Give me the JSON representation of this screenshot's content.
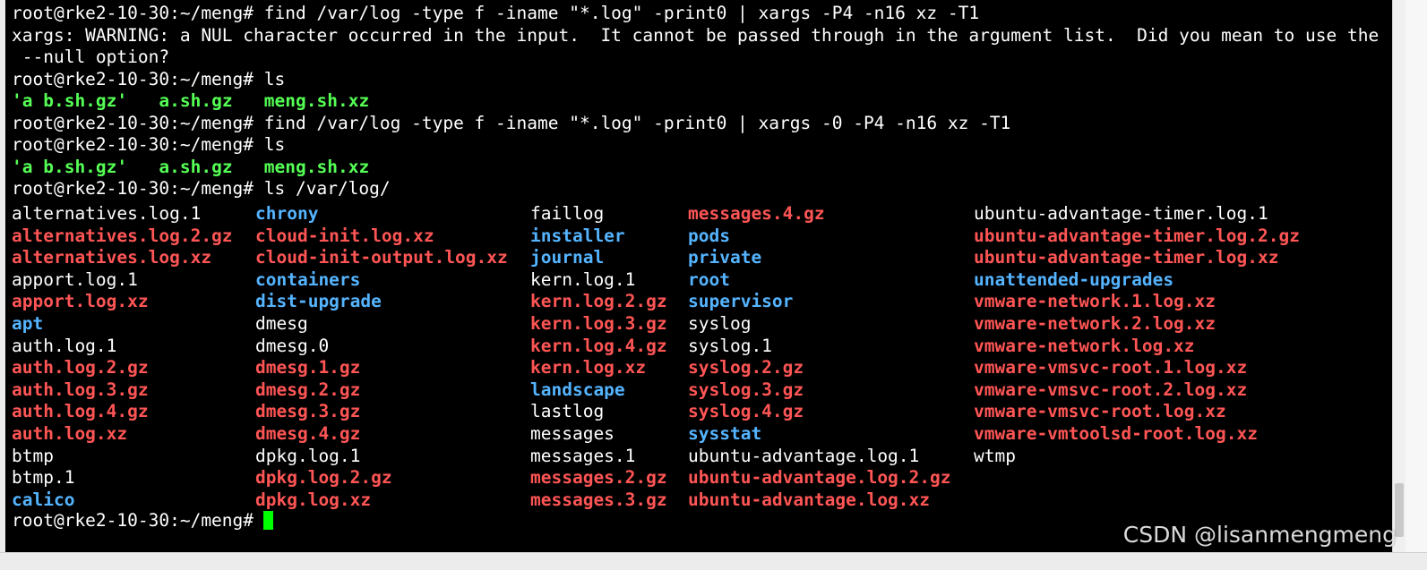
{
  "terminal": {
    "lines": [
      {
        "text": "root@rke2-10-30:~/meng# find /var/log -type f -iname \"*.log\" -print0 | xargs -P4 -n16 xz -T1"
      },
      {
        "text": "xargs: WARNING: a NUL character occurred in the input.  It cannot be passed through in the argument list.  Did you mean to use the"
      },
      {
        "text": " --null option?"
      },
      {
        "text": "root@rke2-10-30:~/meng# ls"
      },
      {
        "files": [
          "'a b.sh.gz'",
          "a.sh.gz",
          "meng.sh.xz"
        ]
      },
      {
        "text": "root@rke2-10-30:~/meng# find /var/log -type f -iname \"*.log\" -print0 | xargs -0 -P4 -n16 xz -T1"
      },
      {
        "text": "root@rke2-10-30:~/meng# ls"
      },
      {
        "files": [
          "'a b.sh.gz'",
          "a.sh.gz",
          "meng.sh.xz"
        ]
      },
      {
        "text": "root@rke2-10-30:~/meng# ls /var/log/"
      }
    ],
    "columns": [
      [
        {
          "name": "alternatives.log.1",
          "type": "plain"
        },
        {
          "name": "alternatives.log.2.gz",
          "type": "arch"
        },
        {
          "name": "alternatives.log.xz",
          "type": "arch"
        },
        {
          "name": "apport.log.1",
          "type": "plain"
        },
        {
          "name": "apport.log.xz",
          "type": "arch"
        },
        {
          "name": "apt",
          "type": "dir"
        },
        {
          "name": "auth.log.1",
          "type": "plain"
        },
        {
          "name": "auth.log.2.gz",
          "type": "arch"
        },
        {
          "name": "auth.log.3.gz",
          "type": "arch"
        },
        {
          "name": "auth.log.4.gz",
          "type": "arch"
        },
        {
          "name": "auth.log.xz",
          "type": "arch"
        },
        {
          "name": "btmp",
          "type": "plain"
        },
        {
          "name": "btmp.1",
          "type": "plain"
        },
        {
          "name": "calico",
          "type": "dir"
        }
      ],
      [
        {
          "name": "chrony",
          "type": "dir"
        },
        {
          "name": "cloud-init.log.xz",
          "type": "arch"
        },
        {
          "name": "cloud-init-output.log.xz",
          "type": "arch"
        },
        {
          "name": "containers",
          "type": "dir"
        },
        {
          "name": "dist-upgrade",
          "type": "dir"
        },
        {
          "name": "dmesg",
          "type": "plain"
        },
        {
          "name": "dmesg.0",
          "type": "plain"
        },
        {
          "name": "dmesg.1.gz",
          "type": "arch"
        },
        {
          "name": "dmesg.2.gz",
          "type": "arch"
        },
        {
          "name": "dmesg.3.gz",
          "type": "arch"
        },
        {
          "name": "dmesg.4.gz",
          "type": "arch"
        },
        {
          "name": "dpkg.log.1",
          "type": "plain"
        },
        {
          "name": "dpkg.log.2.gz",
          "type": "arch"
        },
        {
          "name": "dpkg.log.xz",
          "type": "arch"
        }
      ],
      [
        {
          "name": "faillog",
          "type": "plain"
        },
        {
          "name": "installer",
          "type": "dir"
        },
        {
          "name": "journal",
          "type": "dir"
        },
        {
          "name": "kern.log.1",
          "type": "plain"
        },
        {
          "name": "kern.log.2.gz",
          "type": "arch"
        },
        {
          "name": "kern.log.3.gz",
          "type": "arch"
        },
        {
          "name": "kern.log.4.gz",
          "type": "arch"
        },
        {
          "name": "kern.log.xz",
          "type": "arch"
        },
        {
          "name": "landscape",
          "type": "dir"
        },
        {
          "name": "lastlog",
          "type": "plain"
        },
        {
          "name": "messages",
          "type": "plain"
        },
        {
          "name": "messages.1",
          "type": "plain"
        },
        {
          "name": "messages.2.gz",
          "type": "arch"
        },
        {
          "name": "messages.3.gz",
          "type": "arch"
        }
      ],
      [
        {
          "name": "messages.4.gz",
          "type": "arch"
        },
        {
          "name": "pods",
          "type": "dir"
        },
        {
          "name": "private",
          "type": "dir"
        },
        {
          "name": "root",
          "type": "dir"
        },
        {
          "name": "supervisor",
          "type": "dir"
        },
        {
          "name": "syslog",
          "type": "plain"
        },
        {
          "name": "syslog.1",
          "type": "plain"
        },
        {
          "name": "syslog.2.gz",
          "type": "arch"
        },
        {
          "name": "syslog.3.gz",
          "type": "arch"
        },
        {
          "name": "syslog.4.gz",
          "type": "arch"
        },
        {
          "name": "sysstat",
          "type": "dir"
        },
        {
          "name": "ubuntu-advantage.log.1",
          "type": "plain"
        },
        {
          "name": "ubuntu-advantage.log.2.gz",
          "type": "arch"
        },
        {
          "name": "ubuntu-advantage.log.xz",
          "type": "arch"
        }
      ],
      [
        {
          "name": "ubuntu-advantage-timer.log.1",
          "type": "plain"
        },
        {
          "name": "ubuntu-advantage-timer.log.2.gz",
          "type": "arch"
        },
        {
          "name": "ubuntu-advantage-timer.log.xz",
          "type": "arch"
        },
        {
          "name": "unattended-upgrades",
          "type": "dir"
        },
        {
          "name": "vmware-network.1.log.xz",
          "type": "arch"
        },
        {
          "name": "vmware-network.2.log.xz",
          "type": "arch"
        },
        {
          "name": "vmware-network.log.xz",
          "type": "arch"
        },
        {
          "name": "vmware-vmsvc-root.1.log.xz",
          "type": "arch"
        },
        {
          "name": "vmware-vmsvc-root.2.log.xz",
          "type": "arch"
        },
        {
          "name": "vmware-vmsvc-root.log.xz",
          "type": "arch"
        },
        {
          "name": "vmware-vmtoolsd-root.log.xz",
          "type": "arch"
        },
        {
          "name": "wtmp",
          "type": "plain"
        }
      ]
    ],
    "final_prompt": "root@rke2-10-30:~/meng#",
    "colors": {
      "background": "#000000",
      "text": "#ffffff",
      "archive": "#ff5555",
      "directory": "#55b4ff",
      "quoted_green": "#55ff55",
      "cursor": "#00ff00"
    }
  },
  "watermark": "CSDN @lisanmengmeng"
}
